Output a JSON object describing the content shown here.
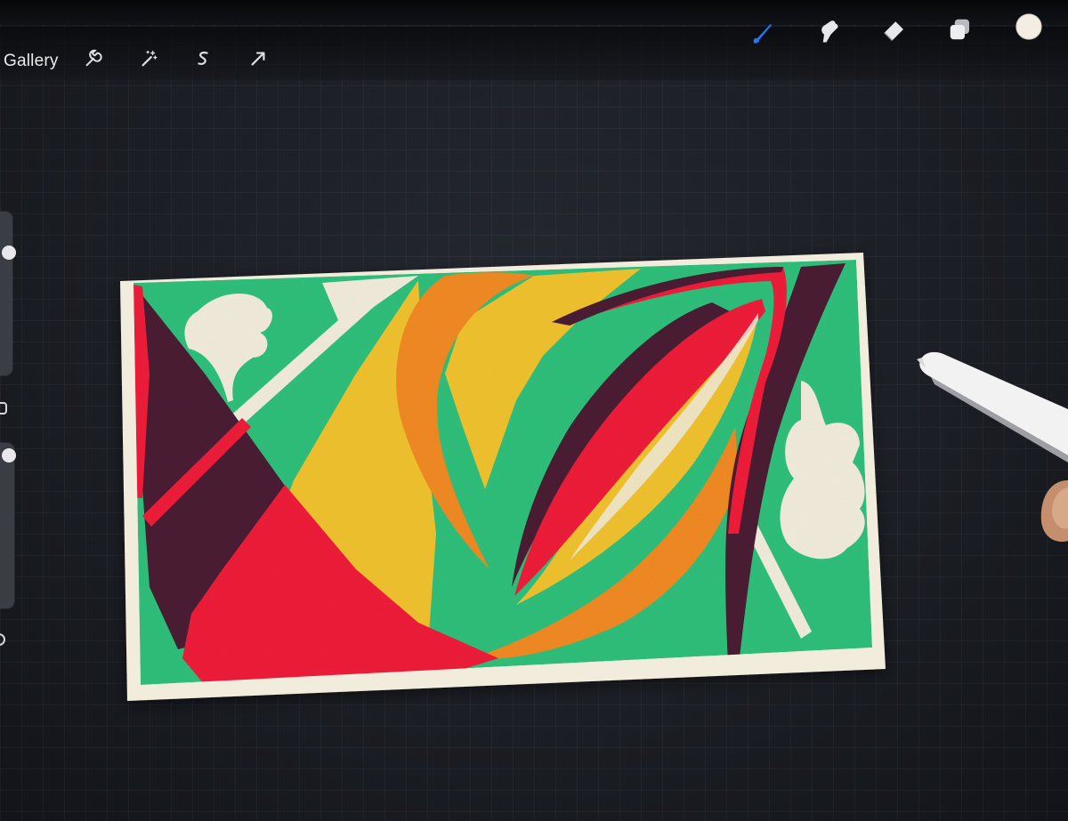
{
  "app": {
    "gallery_label": "Gallery"
  },
  "toolbar": {
    "left_tools": [
      "wrench-icon",
      "magic-wand-icon",
      "selection-icon",
      "move-arrow-icon"
    ],
    "right_tools": [
      "brush-icon",
      "smudge-icon",
      "eraser-icon",
      "layers-icon",
      "color-swatch-icon"
    ],
    "active_tool": "brush-icon",
    "active_color": "#1e7bff",
    "current_color": "#f3ede3"
  },
  "canvas": {
    "palette": {
      "paper": "#f1ecdc",
      "green": "#2fbf7b",
      "yellow": "#f0c22f",
      "orange": "#f08a24",
      "red": "#ee1c3a",
      "plum": "#4a1c33"
    }
  }
}
